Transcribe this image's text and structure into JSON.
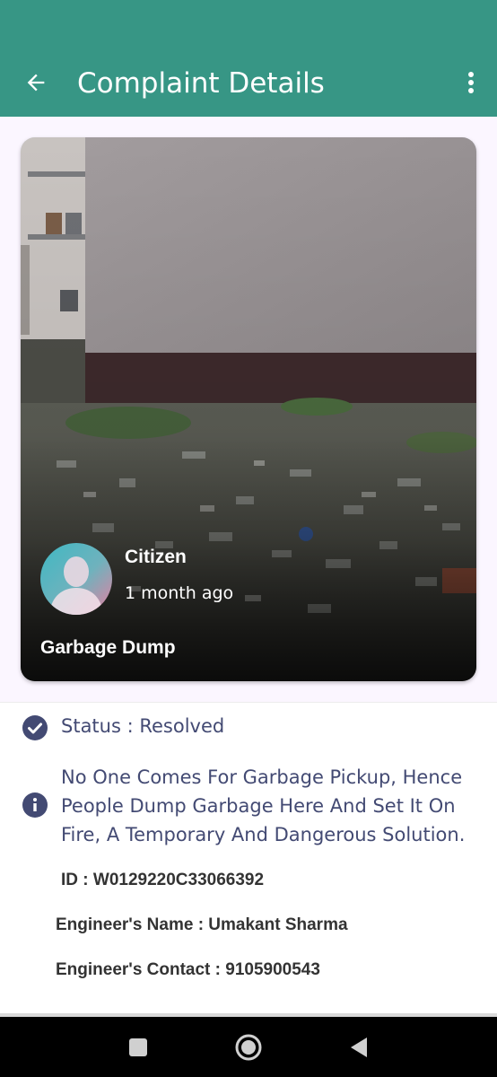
{
  "appbar": {
    "title": "Complaint Details"
  },
  "card": {
    "user_name": "Citizen",
    "time_ago": "1 month ago",
    "issue_title": "Garbage Dump"
  },
  "status": {
    "text": "Status : Resolved"
  },
  "description": "No One Comes For Garbage Pickup, Hence People Dump Garbage Here And Set It On Fire, A Temporary And Dangerous Solution.",
  "details": {
    "id": "ID :  W0129220C33066392",
    "engineer_name": "Engineer's Name : Umakant Sharma",
    "engineer_contact": "Engineer's Contact : 9105900543"
  },
  "colors": {
    "appbar": "#379685",
    "accent_icon": "#434a73",
    "background": "#fbf6ff"
  },
  "icons": [
    "back-arrow-icon",
    "more-vert-icon",
    "check-circle-icon",
    "info-icon",
    "square-icon",
    "home-circle-icon",
    "back-triangle-icon"
  ]
}
